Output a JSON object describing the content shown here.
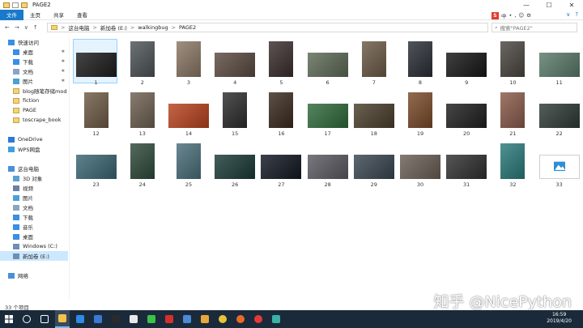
{
  "window": {
    "title": "PAGE2",
    "controls": [
      "—",
      "☐",
      "✕"
    ]
  },
  "ribbon": {
    "tabs": [
      "文件",
      "主页",
      "共享",
      "查看"
    ]
  },
  "ime": {
    "logo": "S",
    "items": [
      "中",
      "•",
      ",",
      "☺",
      "⚙"
    ]
  },
  "nav": {
    "back": "←",
    "forward": "→",
    "recent": "∨",
    "up": "↑"
  },
  "address": {
    "crumbs": [
      "这台电脑",
      "新加卷 (E:)",
      "walkingbug",
      "PAGE2"
    ],
    "separator": ">"
  },
  "search": {
    "placeholder": "搜索\"PAGE2\""
  },
  "sidebar": {
    "items": [
      {
        "label": "快速访问",
        "icon": "star-icon",
        "color": "#3a8ee6",
        "indent": 0
      },
      {
        "label": "桌面",
        "icon": "desktop-icon",
        "color": "#3a8ee6",
        "indent": 1,
        "pin": true
      },
      {
        "label": "下载",
        "icon": "download-icon",
        "color": "#3a8ee6",
        "indent": 1,
        "pin": true
      },
      {
        "label": "文档",
        "icon": "document-icon",
        "color": "#8aa4c4",
        "indent": 1,
        "pin": true
      },
      {
        "label": "图片",
        "icon": "picture-icon",
        "color": "#4aa0d8",
        "indent": 1,
        "pin": true
      },
      {
        "label": "blog随笔存储mod",
        "icon": "folder-icon",
        "color": "#f3d37a",
        "indent": 1
      },
      {
        "label": "fiction",
        "icon": "folder-icon",
        "color": "#f3d37a",
        "indent": 1
      },
      {
        "label": "PAGE",
        "icon": "folder-icon",
        "color": "#f3d37a",
        "indent": 1
      },
      {
        "label": "toscrape_book",
        "icon": "folder-icon",
        "color": "#f3d37a",
        "indent": 1
      },
      {
        "label": "",
        "icon": "",
        "color": "",
        "indent": 0
      },
      {
        "label": "OneDrive",
        "icon": "cloud-icon",
        "color": "#2d7ad6",
        "indent": 0
      },
      {
        "label": "WPS网盘",
        "icon": "cloud-icon",
        "color": "#3aa0e0",
        "indent": 0
      },
      {
        "label": "",
        "icon": "",
        "color": "",
        "indent": 0
      },
      {
        "label": "这台电脑",
        "icon": "computer-icon",
        "color": "#4a90d9",
        "indent": 0
      },
      {
        "label": "3D 对象",
        "icon": "cube-icon",
        "color": "#5aa0d8",
        "indent": 1
      },
      {
        "label": "视频",
        "icon": "video-icon",
        "color": "#6b7fa8",
        "indent": 1
      },
      {
        "label": "图片",
        "icon": "picture-icon",
        "color": "#4aa0d8",
        "indent": 1
      },
      {
        "label": "文档",
        "icon": "document-icon",
        "color": "#8aa4c4",
        "indent": 1
      },
      {
        "label": "下载",
        "icon": "download-icon",
        "color": "#3a8ee6",
        "indent": 1
      },
      {
        "label": "音乐",
        "icon": "music-icon",
        "color": "#3a8ee6",
        "indent": 1
      },
      {
        "label": "桌面",
        "icon": "desktop-icon",
        "color": "#3a8ee6",
        "indent": 1
      },
      {
        "label": "Windows (C:)",
        "icon": "drive-icon",
        "color": "#6d8fb4",
        "indent": 1
      },
      {
        "label": "新加卷 (E:)",
        "icon": "drive-icon",
        "color": "#6d8fb4",
        "indent": 1,
        "selected": true
      },
      {
        "label": "",
        "icon": "",
        "color": "",
        "indent": 0
      },
      {
        "label": "网络",
        "icon": "network-icon",
        "color": "#4a90d9",
        "indent": 0
      }
    ]
  },
  "files": [
    {
      "label": "1",
      "color": "#1c1c1c",
      "selected": true
    },
    {
      "label": "2",
      "color": "#4d5356"
    },
    {
      "label": "3",
      "color": "#8a7764"
    },
    {
      "label": "4",
      "color": "#5b4a40"
    },
    {
      "label": "5",
      "color": "#3a2e2c"
    },
    {
      "label": "6",
      "color": "#5d6a56"
    },
    {
      "label": "7",
      "color": "#6b5a45"
    },
    {
      "label": "8",
      "color": "#2a2e36"
    },
    {
      "label": "9",
      "color": "#161616"
    },
    {
      "label": "10",
      "color": "#4a4640"
    },
    {
      "label": "11",
      "color": "#5a7a6a"
    },
    {
      "label": "12",
      "color": "#6e5b45"
    },
    {
      "label": "13",
      "color": "#6e6050"
    },
    {
      "label": "14",
      "color": "#b8421e"
    },
    {
      "label": "15",
      "color": "#2c2c2c"
    },
    {
      "label": "16",
      "color": "#3a2a1e"
    },
    {
      "label": "17",
      "color": "#2f6a3a"
    },
    {
      "label": "18",
      "color": "#4a3e2c"
    },
    {
      "label": "19",
      "color": "#7a4a2a"
    },
    {
      "label": "20",
      "color": "#1e1e1e"
    },
    {
      "label": "21",
      "color": "#8a5a4a"
    },
    {
      "label": "22",
      "color": "#2e3a36"
    },
    {
      "label": "23",
      "color": "#3a6672"
    },
    {
      "label": "24",
      "color": "#2e4a3a"
    },
    {
      "label": "25",
      "color": "#4a6e7a"
    },
    {
      "label": "26",
      "color": "#1a3a36"
    },
    {
      "label": "27",
      "color": "#121822"
    },
    {
      "label": "28",
      "color": "#5a5a62"
    },
    {
      "label": "29",
      "color": "#3a4650"
    },
    {
      "label": "30",
      "color": "#6a5e56"
    },
    {
      "label": "31",
      "color": "#303030"
    },
    {
      "label": "32",
      "color": "#2a7a7a"
    },
    {
      "label": "33",
      "color": "#ffffff",
      "icon": "image-file-icon"
    }
  ],
  "status": {
    "text": "33 个项目"
  },
  "watermark": "知乎 @NicePython",
  "taskbar": {
    "apps": [
      {
        "name": "cortana",
        "color": "#ffffff"
      },
      {
        "name": "task-view",
        "color": "#ffffff"
      },
      {
        "name": "file-explorer",
        "color": "#f3c24a",
        "active": true
      },
      {
        "name": "app-blue",
        "color": "#2e8ae6"
      },
      {
        "name": "app-script",
        "color": "#3a7ad6"
      },
      {
        "name": "terminal",
        "color": "#2b2b2b"
      },
      {
        "name": "app-penguin",
        "color": "#e8e8e8"
      },
      {
        "name": "wechat",
        "color": "#3ac24a"
      },
      {
        "name": "app-red",
        "color": "#d6302a"
      },
      {
        "name": "app-note",
        "color": "#4a8ad6"
      },
      {
        "name": "app-grid",
        "color": "#e8a83a"
      },
      {
        "name": "chrome",
        "color": "#e8c23a"
      },
      {
        "name": "app-fox",
        "color": "#e86a2a"
      },
      {
        "name": "netease",
        "color": "#e23a3a"
      },
      {
        "name": "photos",
        "color": "#3ab2a8"
      }
    ],
    "time": "16:59",
    "date": "2019/4/20"
  }
}
